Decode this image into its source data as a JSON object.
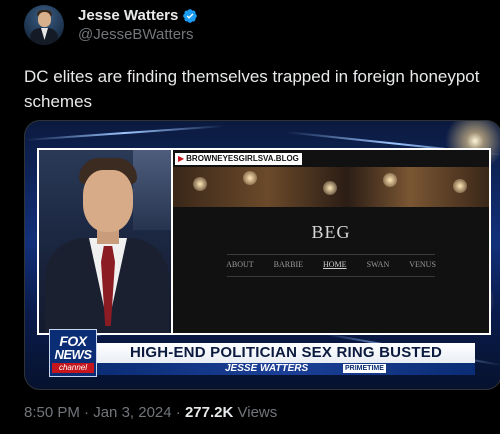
{
  "author": {
    "display_name": "Jesse Watters",
    "handle": "@JesseBWatters",
    "verified_icon": "verified-badge-icon",
    "verified_color": "#1d9bf0"
  },
  "tweet": {
    "text": "DC elites are finding themselves trapped in foreign honeypot schemes"
  },
  "media": {
    "url_label": "BROWNEYESGIRLSVA.BLOG",
    "site_title": "BEG",
    "site_nav": [
      "ABOUT",
      "BARBIE",
      "HOME",
      "SWAN",
      "VENUS"
    ],
    "site_nav_active": "HOME",
    "fox_logo": {
      "line1": "FOX",
      "line2": "NEWS",
      "line3": "channel"
    },
    "headline": "HIGH-END POLITICIAN SEX RING BUSTED",
    "show_name": "JESSE WATTERS",
    "show_tag": "PRIMETIME"
  },
  "footer": {
    "time": "8:50 PM",
    "separator": "·",
    "date": "Jan 3, 2024",
    "views_count": "277.2K",
    "views_label": "Views"
  }
}
